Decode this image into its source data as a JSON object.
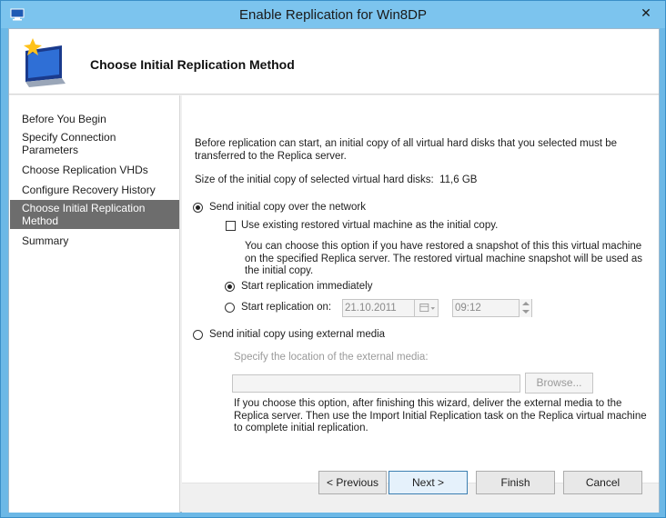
{
  "window": {
    "title": "Enable Replication for Win8DP"
  },
  "header": {
    "title": "Choose Initial Replication Method"
  },
  "nav": {
    "items": [
      {
        "label": "Before You Begin"
      },
      {
        "label": "Specify Connection\nParameters"
      },
      {
        "label": "Choose Replication VHDs"
      },
      {
        "label": "Configure Recovery History"
      },
      {
        "label": "Choose Initial Replication\nMethod"
      },
      {
        "label": "Summary"
      }
    ],
    "selected_index": 4
  },
  "content": {
    "intro": "Before replication can start, an initial copy of all virtual hard disks that you selected must be transferred to the Replica server.",
    "size_label": "Size of the initial copy of selected virtual hard disks:",
    "size_value": "11,6 GB",
    "option_network": "Send initial copy over the network",
    "use_existing_label": "Use existing restored virtual machine as the initial copy.",
    "use_existing_desc": "You can choose this option if you have restored a snapshot of this this virtual machine on the specified Replica server. The restored virtual machine snapshot will be used as the initial copy.",
    "start_immediately": "Start replication immediately",
    "start_on": "Start replication on:",
    "start_date": "21.10.2011",
    "start_time": "09:12",
    "option_external": "Send initial copy using external media",
    "location_label": "Specify the location of the external media:",
    "location_value": "",
    "browse_label": "Browse...",
    "external_desc": "If you choose this option, after finishing this wizard, deliver the external media to the Replica server. Then use the Import Initial Replication task on the Replica virtual machine to complete initial replication."
  },
  "footer": {
    "previous": "< Previous",
    "next": "Next >",
    "finish": "Finish",
    "cancel": "Cancel"
  },
  "colors": {
    "nav_selected": "#6d6d6d",
    "titlebar": "#7cc4ee"
  }
}
